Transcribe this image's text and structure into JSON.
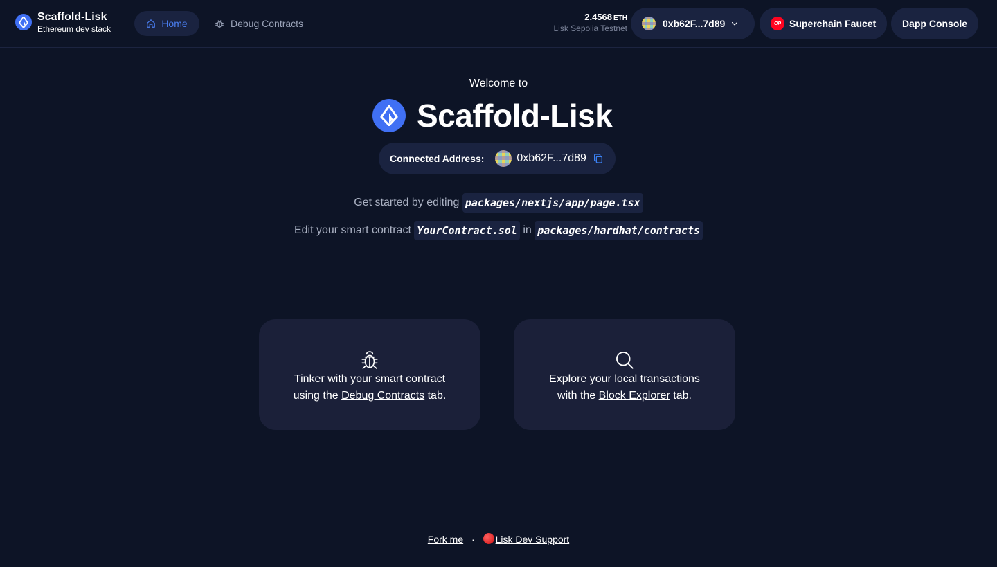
{
  "header": {
    "brand_title": "Scaffold-Lisk",
    "brand_subtitle": "Ethereum dev stack",
    "nav": [
      {
        "label": "Home",
        "icon": "home-icon",
        "active": true
      },
      {
        "label": "Debug Contracts",
        "icon": "bug-icon",
        "active": false
      }
    ],
    "balance_value": "2.4568",
    "balance_unit": "ETH",
    "network": "Lisk Sepolia Testnet",
    "account_address": "0xb62F...7d89",
    "faucet_label": "Superchain Faucet",
    "faucet_badge": "OP",
    "console_label": "Dapp Console"
  },
  "hero": {
    "welcome": "Welcome to",
    "title": "Scaffold-Lisk",
    "connected_label": "Connected Address:",
    "connected_address": "0xb62F...7d89"
  },
  "instructions": {
    "line1_text": "Get started by editing",
    "line1_code": "packages/nextjs/app/page.tsx",
    "line2_text": "Edit your smart contract",
    "line2_code1": "YourContract.sol",
    "line2_in": "in",
    "line2_code2": "packages/hardhat/contracts"
  },
  "cards": {
    "debug": {
      "line1": "Tinker with your smart contract",
      "prefix": "using the",
      "link": "Debug Contracts",
      "suffix": "tab."
    },
    "explorer": {
      "line1": "Explore your local transactions",
      "prefix": "with the",
      "link": "Block Explorer",
      "suffix": "tab."
    }
  },
  "footer": {
    "fork_label": "Fork me",
    "separator": "·",
    "support_label": "Lisk Dev Support"
  },
  "colors": {
    "background": "#0d1426",
    "surface": "#1a2340",
    "accent": "#4070f4",
    "nav_active": "#4a7ef0"
  }
}
